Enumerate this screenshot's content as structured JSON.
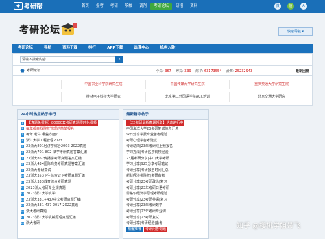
{
  "header": {
    "logo_text": "考研帮",
    "nav": [
      "首页",
      "报考",
      "考研",
      "院校",
      "调剂",
      "考研论坛",
      "研招",
      "资料"
    ],
    "active_index": 5,
    "icons": [
      "weibo-icon",
      "wechat-icon",
      "app-icon"
    ],
    "icon_glyphs": [
      "微",
      "信",
      "A"
    ]
  },
  "hero": {
    "brand": "考研论坛",
    "quick_nav": "快速导航 ▾"
  },
  "nav2": [
    "考研论坛",
    "导航",
    "资料下载",
    "排行",
    "APP下载",
    "选课中心",
    "机构入驻"
  ],
  "search": {
    "placeholder": "请输入搜索内容",
    "button_glyph": "⌕"
  },
  "crumb": {
    "label": "考研论坛",
    "stats": [
      {
        "label": "今日:",
        "value": "367"
      },
      {
        "label": "昨日:",
        "value": "339"
      },
      {
        "label": "帖子:",
        "value": "63173554"
      },
      {
        "label": "会员:",
        "value": "25232943"
      }
    ],
    "latest": "最新回复"
  },
  "links": {
    "row1": [
      "中国农业科学院研究生院",
      "中国传媒大学研究生院",
      "重庆交通大学研究生院"
    ],
    "row2": [
      "桂林电子科技大学研究",
      "北京第二外国语学院ACC培训",
      "北京交通大学研究"
    ]
  },
  "panel_left": {
    "title": "24小时热点帖子排行",
    "items": [
      {
        "text": "【真题免费领】80000套考研真题限时免费领",
        "style": "bar"
      },
      {
        "text": "每年都来找院校管理的简单报名",
        "style": "hl"
      },
      {
        "text": "每年 老鸟 哪些方面？",
        "style": ""
      },
      {
        "text": "浙江大学工程管理2023",
        "style": ""
      },
      {
        "text": "23浙大801经济学综合2003-2022真题",
        "style": ""
      },
      {
        "text": "23浙大701-802-法学考研真题答案汇编",
        "style": ""
      },
      {
        "text": "23浙大862传播学考研真题答案汇编",
        "style": ""
      },
      {
        "text": "23浙大434国际商务考研真题答案汇编",
        "style": ""
      },
      {
        "text": "23浙大考研复试",
        "style": ""
      },
      {
        "text": "23浙大353卫生综合公卫考研真题汇编",
        "style": ""
      },
      {
        "text": "23浙大333教育综合考研真题",
        "style": ""
      },
      {
        "text": "2023浙大考研专业课真题",
        "style": ""
      },
      {
        "text": "2023浙江大学农学",
        "style": ""
      },
      {
        "text": "23浙大331+437中文考研真题汇编",
        "style": ""
      },
      {
        "text": "23浙大331-437 2017-2022真题",
        "style": ""
      },
      {
        "text": "浙大考研真题",
        "style": ""
      },
      {
        "text": "2023浙江大学机械原理真题汇编",
        "style": ""
      },
      {
        "text": "浙大考研",
        "style": ""
      }
    ]
  },
  "panel_right": {
    "title": "最新精华帖子",
    "items": [
      {
        "text": "【22考研最新真题领取】活动进行中",
        "style": "bar"
      },
      {
        "text": "中国海洋大学23考研复试信息汇总",
        "style": ""
      },
      {
        "text": "今日分享学费专业备考经验",
        "style": ""
      },
      {
        "text": "考研心理学备考建议",
        "style": ""
      },
      {
        "text": "考研动向|23年考研线上预报名",
        "style": ""
      },
      {
        "text": "学习方法|考研医学院校经验",
        "style": ""
      },
      {
        "text": "23届考研分享|中山大学考研",
        "style": ""
      },
      {
        "text": "学习分享|925分享考研笔记",
        "style": ""
      },
      {
        "text": "考研分享|考研报名时间汇总",
        "style": ""
      },
      {
        "text": "新财经济类院校|考研备考",
        "style": ""
      },
      {
        "text": "考研分享|23考研政治|复习",
        "style": ""
      },
      {
        "text": "考研分享|23年考研日语考研",
        "style": ""
      },
      {
        "text": "恩格尔经济学原理考研经验",
        "style": ""
      },
      {
        "text": "考研分享|23考研英语|复习",
        "style": ""
      },
      {
        "text": "考研分享|23年考研数学",
        "style": ""
      },
      {
        "text": "考研分享|23年考研专业课",
        "style": ""
      },
      {
        "text": "考研分享|23考研复试",
        "style": ""
      },
      {
        "text": "考研分享|考研经验|备考",
        "style": ""
      },
      {
        "text": "精编推荐",
        "style": "tag",
        "extra": "考研问卷专题"
      }
    ]
  },
  "right_col": {
    "title": "最新回复"
  },
  "watermark": "知乎 @樱桃学姐带飞"
}
